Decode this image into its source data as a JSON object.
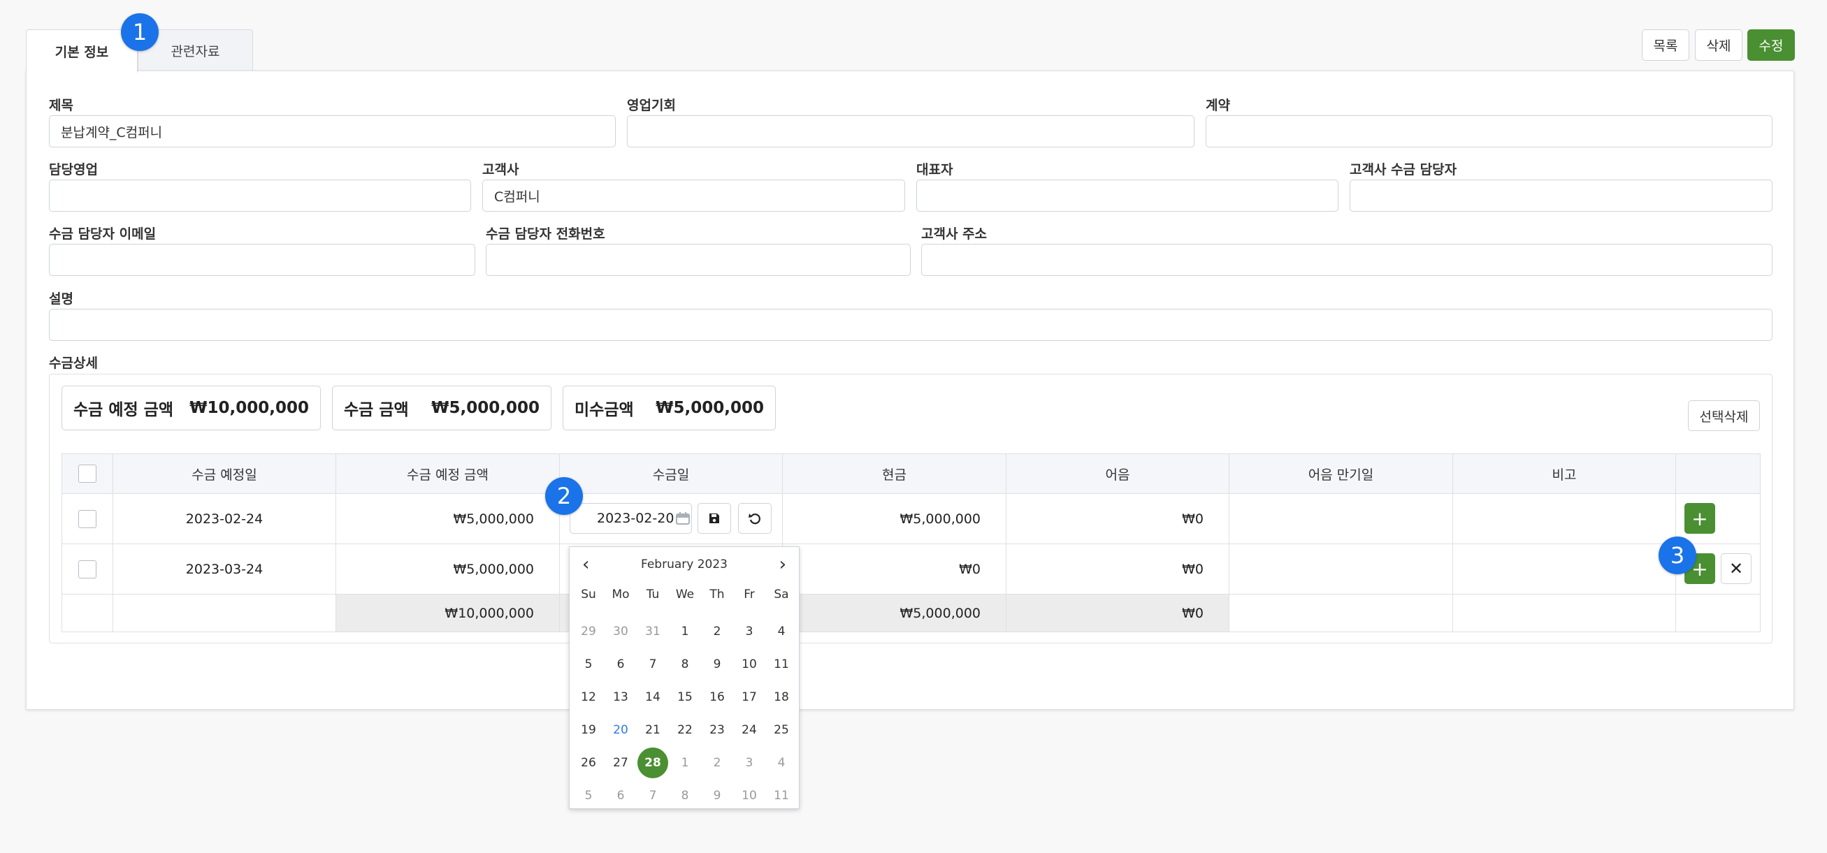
{
  "tabs": [
    {
      "label": "기본 정보"
    },
    {
      "label": "관련자료"
    }
  ],
  "markers": [
    "1",
    "2",
    "3"
  ],
  "toolbar": {
    "list_label": "목록",
    "delete_label": "삭제",
    "edit_label": "수정"
  },
  "form": {
    "title": {
      "label": "제목",
      "value": "분납계약_C컴퍼니"
    },
    "opportunity": {
      "label": "영업기회",
      "value": ""
    },
    "contract": {
      "label": "계약",
      "value": ""
    },
    "sales_rep": {
      "label": "담당영업",
      "value": ""
    },
    "customer": {
      "label": "고객사",
      "value": "C컴퍼니"
    },
    "ceo": {
      "label": "대표자",
      "value": ""
    },
    "collector": {
      "label": "고객사 수금 담당자",
      "value": ""
    },
    "collector_email": {
      "label": "수금 담당자 이메일",
      "value": ""
    },
    "collector_phone": {
      "label": "수금 담당자 전화번호",
      "value": ""
    },
    "address": {
      "label": "고객사 주소",
      "value": ""
    },
    "description": {
      "label": "설명",
      "value": ""
    }
  },
  "detail": {
    "label": "수금상세",
    "summary": [
      {
        "label": "수금 예정 금액",
        "value": "₩10,000,000"
      },
      {
        "label": "수금 금액",
        "value": "₩5,000,000"
      },
      {
        "label": "미수금액",
        "value": "₩5,000,000"
      }
    ],
    "delete_selected": "선택삭제",
    "columns": [
      "수금 예정일",
      "수금 예정 금액",
      "수금일",
      "현금",
      "어음",
      "어음 만기일",
      "비고"
    ],
    "rows": [
      {
        "due_date": "2023-02-24",
        "due_amount": "₩5,000,000",
        "paid_date": "2023-02-20",
        "cash": "₩5,000,000",
        "bill": "₩0",
        "bill_due": "",
        "note": ""
      },
      {
        "due_date": "2023-03-24",
        "due_amount": "₩5,000,000",
        "paid_date": "",
        "cash": "₩0",
        "bill": "₩0",
        "bill_due": "",
        "note": ""
      }
    ],
    "totals": {
      "due_amount": "₩10,000,000",
      "cash": "₩5,000,000",
      "bill": "₩0"
    }
  },
  "calendar": {
    "month_label": "February 2023",
    "prev": "‹",
    "next": "›",
    "weekdays": [
      "Su",
      "Mo",
      "Tu",
      "We",
      "Th",
      "Fr",
      "Sa"
    ],
    "weeks": [
      [
        "29",
        "30",
        "31",
        "1",
        "2",
        "3",
        "4"
      ],
      [
        "5",
        "6",
        "7",
        "8",
        "9",
        "10",
        "11"
      ],
      [
        "12",
        "13",
        "14",
        "15",
        "16",
        "17",
        "18"
      ],
      [
        "19",
        "20",
        "21",
        "22",
        "23",
        "24",
        "25"
      ],
      [
        "26",
        "27",
        "28",
        "1",
        "2",
        "3",
        "4"
      ],
      [
        "5",
        "6",
        "7",
        "8",
        "9",
        "10",
        "11"
      ]
    ],
    "today": "20",
    "selected": "28"
  },
  "icons": {
    "plus": "+",
    "close": "✕",
    "calendar": "calendar-icon",
    "save": "save-icon",
    "undo": "undo-icon"
  },
  "colors": {
    "accent_green": "#4a8f32",
    "marker_blue": "#1a73e8",
    "today_blue": "#2b7de9"
  }
}
